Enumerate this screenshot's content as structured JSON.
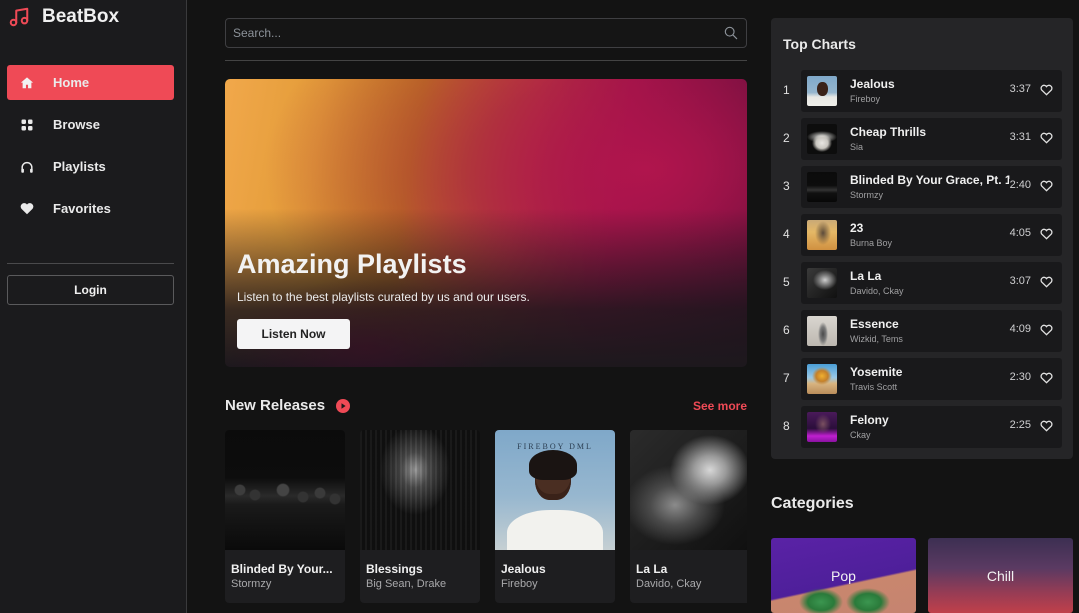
{
  "app": {
    "name": "BeatBox"
  },
  "sidebar": {
    "items": [
      {
        "label": "Home",
        "icon": "home-icon",
        "active": true
      },
      {
        "label": "Browse",
        "icon": "grid-icon",
        "active": false
      },
      {
        "label": "Playlists",
        "icon": "headphones-icon",
        "active": false
      },
      {
        "label": "Favorites",
        "icon": "heart-icon",
        "active": false
      }
    ],
    "login_label": "Login"
  },
  "search": {
    "placeholder": "Search...",
    "value": ""
  },
  "hero": {
    "title": "Amazing Playlists",
    "subtitle": "Listen to the best playlists curated by us and our users.",
    "button_label": "Listen Now"
  },
  "new_releases": {
    "title": "New Releases",
    "see_more_label": "See more",
    "items": [
      {
        "title": "Blinded By Your...",
        "artist": "Stormzy"
      },
      {
        "title": "Blessings",
        "artist": "Big Sean, Drake"
      },
      {
        "title": "Jealous",
        "artist": "Fireboy",
        "art_text": "FIREBOY DML"
      },
      {
        "title": "La La",
        "artist": "Davido, Ckay"
      }
    ]
  },
  "top_charts": {
    "title": "Top Charts",
    "items": [
      {
        "rank": "1",
        "title": "Jealous",
        "artist": "Fireboy",
        "duration": "3:37"
      },
      {
        "rank": "2",
        "title": "Cheap Thrills",
        "artist": "Sia",
        "duration": "3:31"
      },
      {
        "rank": "3",
        "title": "Blinded By Your Grace, Pt. 1",
        "artist": "Stormzy",
        "duration": "2:40"
      },
      {
        "rank": "4",
        "title": "23",
        "artist": "Burna Boy",
        "duration": "4:05"
      },
      {
        "rank": "5",
        "title": "La La",
        "artist": "Davido, Ckay",
        "duration": "3:07"
      },
      {
        "rank": "6",
        "title": "Essence",
        "artist": "Wizkid, Tems",
        "duration": "4:09"
      },
      {
        "rank": "7",
        "title": "Yosemite",
        "artist": "Travis Scott",
        "duration": "2:30"
      },
      {
        "rank": "8",
        "title": "Felony",
        "artist": "Ckay",
        "duration": "2:25"
      }
    ]
  },
  "categories": {
    "title": "Categories",
    "items": [
      {
        "label": "Pop"
      },
      {
        "label": "Chill"
      }
    ]
  },
  "colors": {
    "accent": "#ef4a56",
    "background": "#131313",
    "sidebar": "#1b1b1d",
    "panel": "#252527",
    "card": "#1e1e20"
  }
}
